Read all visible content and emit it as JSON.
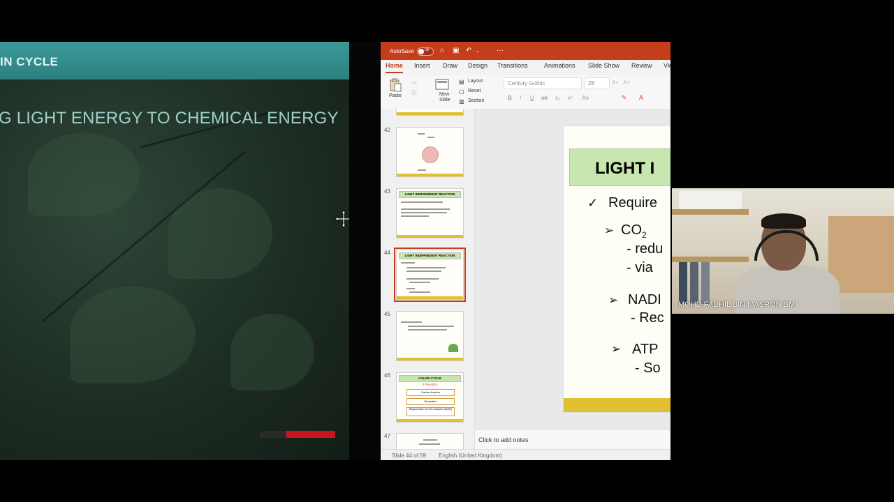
{
  "left_slide": {
    "header": "IN CYCLE",
    "subtitle": "G LIGHT ENERGY TO CHEMICAL ENERGY"
  },
  "ppt": {
    "titlebar": {
      "autosave_label": "AutoSave",
      "autosave_state": "Off"
    },
    "tabs": [
      "Home",
      "Insert",
      "Draw",
      "Design",
      "Transitions",
      "Animations",
      "Slide Show",
      "Review",
      "Vie"
    ],
    "ribbon": {
      "paste": "Paste",
      "new_slide": "New Slide",
      "layout": "Layout",
      "reset": "Reset",
      "section": "Section",
      "font_name": "Century Gothic",
      "font_size": "28"
    },
    "thumbnails": [
      {
        "number": "42"
      },
      {
        "number": "43",
        "title": "LIGHT INDEPENDENT REACTION"
      },
      {
        "number": "44",
        "title": "LIGHT INDEPENDENT REACTION"
      },
      {
        "number": "45"
      },
      {
        "number": "46",
        "title": "CALVIN CYCLE",
        "subtitle": "3 PHASES",
        "boxes": [
          "Carbon fixation",
          "Reduction",
          "Regeneration of CO2 acceptor (RuBP)"
        ]
      },
      {
        "number": "47"
      }
    ],
    "main_slide": {
      "title": "LIGHT I",
      "line1": "Require",
      "line2_prefix": "CO",
      "line2_sub": "2",
      "line3": "- redu",
      "line4": "- via",
      "line5": "NADI",
      "line6": "- Rec",
      "line7": "ATP",
      "line8": "- So"
    },
    "notes_placeholder": "Click to add notes",
    "status": {
      "slide_counter": "Slide 44 of 59",
      "language": "English (United Kingdom)"
    }
  },
  "webcam": {
    "name": "MOHD FADHIL BIN MASRON BM"
  }
}
